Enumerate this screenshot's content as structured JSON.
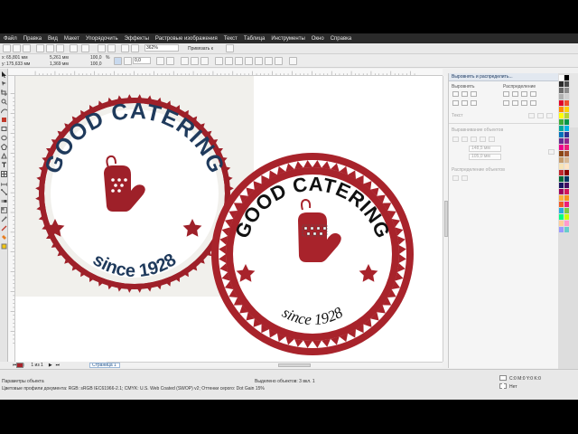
{
  "menu": [
    "Файл",
    "Правка",
    "Вид",
    "Макет",
    "Упорядочить",
    "Эффекты",
    "Растровые изображения",
    "Текст",
    "Таблица",
    "Инструменты",
    "Окно",
    "Справка"
  ],
  "toolbar": {
    "zoom": "362%",
    "snap_label": "Привязать к",
    "x_label": "x:",
    "x_value": "65,801 мм",
    "y_label": "y:",
    "y_value": "175,633 мм",
    "w_value": "5,261 мм",
    "h_value": "1,369 мм",
    "scale_x": "100,0",
    "scale_y": "100,0",
    "percent": "%",
    "angle": "0,0"
  },
  "docker": {
    "title": "Выровнять и распределить...",
    "align_label": "Выровнять",
    "distribute_label": "Распределение",
    "text_label": "Текст",
    "objects_align_label": "Выравнивание объектов",
    "field1": "148,5 мм",
    "field2": "105,0 мм",
    "distribute_objects_label": "Распределение объектов"
  },
  "pages": {
    "counter": "1 из 1",
    "tab": "Страница 1"
  },
  "status": {
    "line1_left": "Параметры объекта",
    "line1_center": "Выделено объектов: 3 вкл. 1",
    "line2": "Цветовые профили документа: RGB: sRGB IEC61966-2.1; CMYK: U.S. Web Coated (SWOP) v2; Оттенки серого: Dot Gain 15%",
    "cmyk_label": "C:0 M:0 Y:0 K:0",
    "fill_none_label": "Нет"
  },
  "logos": {
    "left": {
      "top_text": "GOOD CATERING",
      "bottom_text": "since 1928"
    },
    "right": {
      "top_text": "GOOD CATERING",
      "bottom_text": "since 1928"
    }
  },
  "colors": {
    "brand_red": "#a8232b",
    "navy": "#1f3a5c",
    "palette": [
      "#ffffff",
      "#000000",
      "#2b2b2b",
      "#4a4a4a",
      "#6a6a6a",
      "#8c8c8c",
      "#b0b0b0",
      "#d0d0d0",
      "#e0002a",
      "#f04a2a",
      "#ff8a00",
      "#ffd200",
      "#ffff00",
      "#b8d432",
      "#3caa36",
      "#00964a",
      "#00a99d",
      "#00b4e6",
      "#0072bc",
      "#2e3192",
      "#662d91",
      "#92278f",
      "#ec008c",
      "#ed1c7a",
      "#8b4513",
      "#a0522d",
      "#c69c6d",
      "#d8b996",
      "#f7e3b5",
      "#ffe4c4",
      "#c1272d",
      "#8b0000",
      "#006837",
      "#003663",
      "#1b1464",
      "#440e62",
      "#9e005d",
      "#d4145a",
      "#fbb03b",
      "#f7931e",
      "#f15a24",
      "#ed1e79",
      "#29abe2",
      "#7ac943",
      "#00ff7f",
      "#ccff00",
      "#ffcc99",
      "#ff99cc",
      "#9999ff",
      "#66cccc"
    ]
  }
}
